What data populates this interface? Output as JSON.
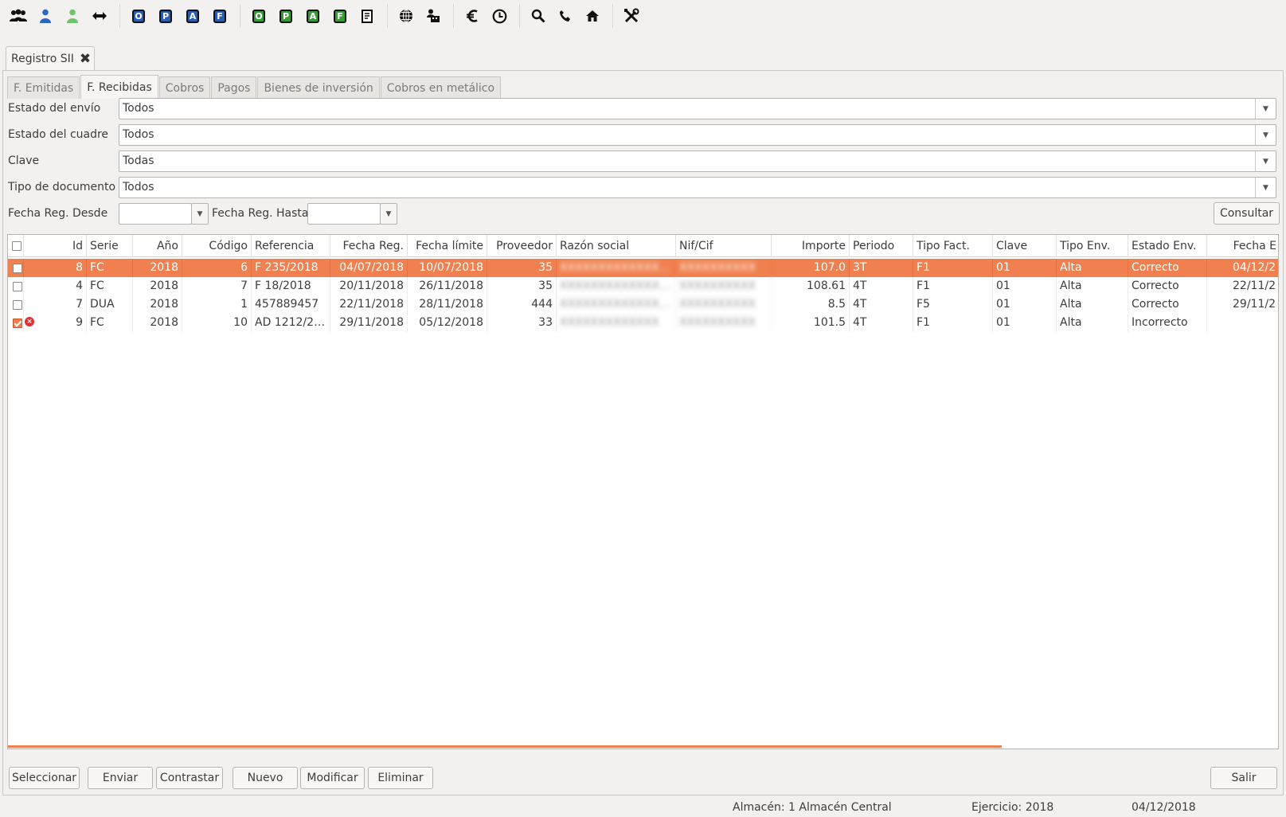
{
  "toolbar": {
    "icons": [
      "users-icon",
      "user-icon",
      "user-green-icon",
      "transfer-arrows-icon",
      "doc-o-blue-icon",
      "doc-p-blue-icon",
      "doc-a-blue-icon",
      "doc-f-blue-icon",
      "doc-o-green-icon",
      "doc-p-green-icon",
      "doc-a-green-icon",
      "doc-f-green-icon",
      "document-list-icon",
      "globe-icon",
      "person-building-icon",
      "euro-icon",
      "clock-icon",
      "search-icon",
      "phone-icon",
      "home-icon",
      "tools-icon"
    ],
    "letters": {
      "o": "O",
      "p": "P",
      "a": "A",
      "f": "F"
    }
  },
  "window_tab": {
    "label": "Registro SII",
    "close": "✖"
  },
  "subtabs": [
    {
      "label": "F. Emitidas",
      "active": false
    },
    {
      "label": "F. Recibidas",
      "active": true
    },
    {
      "label": "Cobros",
      "active": false
    },
    {
      "label": "Pagos",
      "active": false
    },
    {
      "label": "Bienes de inversión",
      "active": false
    },
    {
      "label": "Cobros en metálico",
      "active": false
    }
  ],
  "filters": {
    "estado_envio": {
      "label": "Estado del envío",
      "value": "Todos"
    },
    "estado_cuadre": {
      "label": "Estado del cuadre",
      "value": "Todos"
    },
    "clave": {
      "label": "Clave",
      "value": "Todas"
    },
    "tipo_documento": {
      "label": "Tipo de documento",
      "value": "Todos"
    },
    "fecha_desde": {
      "label": "Fecha Reg. Desde",
      "value": ""
    },
    "fecha_hasta": {
      "label": "Fecha Reg. Hasta",
      "value": ""
    },
    "consultar": "Consultar"
  },
  "table": {
    "columns": [
      "Id",
      "Serie",
      "Año",
      "Código",
      "Referencia",
      "Fecha Reg.",
      "Fecha límite",
      "Proveedor",
      "Razón social",
      "Nif/Cif",
      "Importe",
      "Periodo",
      "Tipo Fact.",
      "Clave",
      "Tipo Env.",
      "Estado Env.",
      "Fecha E"
    ],
    "rows": [
      {
        "checked": false,
        "error": false,
        "selected": true,
        "id": "8",
        "serie": "FC",
        "anio": "2018",
        "codigo": "6",
        "referencia": "F 235/2018",
        "fecha_reg": "04/07/2018",
        "fecha_limite": "10/07/2018",
        "proveedor": "35",
        "razon_social": "XXXXXXXXXXXXXXXXXX...",
        "nif": "XXXXXXXXXX",
        "importe": "107.0",
        "periodo": "3T",
        "tipo_fact": "F1",
        "clave": "01",
        "tipo_env": "Alta",
        "estado_env": "Correcto",
        "fecha_env": "04/12/2"
      },
      {
        "checked": false,
        "error": false,
        "selected": false,
        "id": "4",
        "serie": "FC",
        "anio": "2018",
        "codigo": "7",
        "referencia": "F 18/2018",
        "fecha_reg": "20/11/2018",
        "fecha_limite": "26/11/2018",
        "proveedor": "35",
        "razon_social": "XXXXXXXXXXXXXXXXXX...",
        "nif": "XXXXXXXXXX",
        "importe": "108.61",
        "periodo": "4T",
        "tipo_fact": "F1",
        "clave": "01",
        "tipo_env": "Alta",
        "estado_env": "Correcto",
        "fecha_env": "22/11/2"
      },
      {
        "checked": false,
        "error": false,
        "selected": false,
        "id": "7",
        "serie": "DUA",
        "anio": "2018",
        "codigo": "1",
        "referencia": "457889457",
        "fecha_reg": "22/11/2018",
        "fecha_limite": "28/11/2018",
        "proveedor": "444",
        "razon_social": "XXXXXXXXXXXXXXXXXX...",
        "nif": "XXXXXXXXXX",
        "importe": "8.5",
        "periodo": "4T",
        "tipo_fact": "F5",
        "clave": "01",
        "tipo_env": "Alta",
        "estado_env": "Correcto",
        "fecha_env": "29/11/2"
      },
      {
        "checked": true,
        "error": true,
        "selected": false,
        "id": "9",
        "serie": "FC",
        "anio": "2018",
        "codigo": "10",
        "referencia": "AD 1212/20...",
        "fecha_reg": "29/11/2018",
        "fecha_limite": "05/12/2018",
        "proveedor": "33",
        "razon_social": "XXXXXXXXXXXXX",
        "nif": "XXXXXXXXXX",
        "importe": "101.5",
        "periodo": "4T",
        "tipo_fact": "F1",
        "clave": "01",
        "tipo_env": "Alta",
        "estado_env": "Incorrecto",
        "fecha_env": ""
      }
    ]
  },
  "buttons": {
    "seleccionar": "Seleccionar",
    "enviar": "Enviar",
    "contrastar": "Contrastar",
    "nuevo": "Nuevo",
    "modificar": "Modificar",
    "eliminar": "Eliminar",
    "salir": "Salir"
  },
  "status": {
    "almacen": "Almacén: 1 Almacén Central",
    "ejercicio": "Ejercicio: 2018",
    "fecha": "04/12/2018"
  },
  "colors": {
    "selection": "#f0804f",
    "error": "#e03030"
  }
}
